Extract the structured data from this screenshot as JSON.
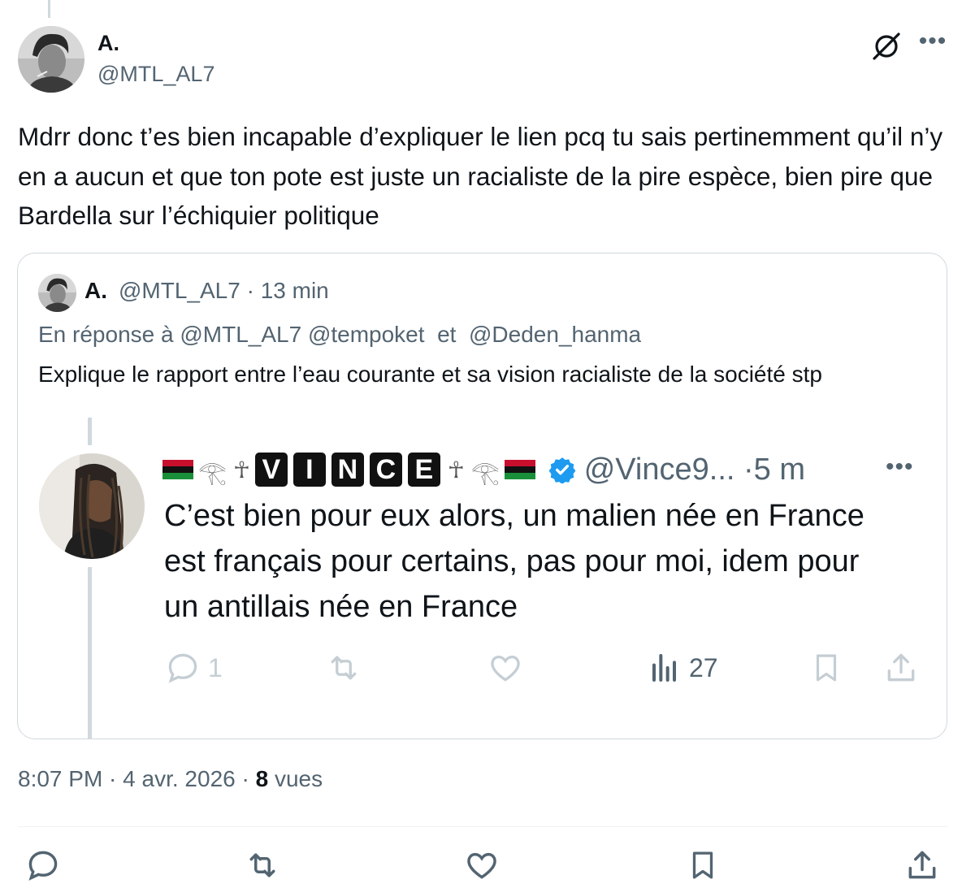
{
  "author": {
    "name": "A.",
    "handle": "@MTL_AL7",
    "avatar_icon": "portrait-avatar-icon"
  },
  "header_icons": [
    "grok-icon",
    "more-icon"
  ],
  "tweet": {
    "text": "Mdrr donc t’es bien incapable d’expliquer le lien pcq tu sais pertinemment qu’il n’y en a aucun et que ton pote est juste un racialiste de la pire espèce, bien pire que Bardella sur l’échiquier politique"
  },
  "quote": {
    "name": "A.",
    "handle_time": "@MTL_AL7 · 13 min",
    "reply_to": "En réponse à @MTL_AL7 @tempoket  et  @Deden_hanma",
    "text": "Explique le rapport entre l’eau courante et sa vision racialiste de la société stp",
    "inner": {
      "name_letters": [
        "V",
        "I",
        "N",
        "C",
        "E"
      ],
      "handle_time": "@Vince9... ·5 m",
      "text": "C’est bien pour eux alors, un malien née en France est français pour certains, pas pour moi,  idem pour un antillais née en France",
      "reply_count": "1",
      "views_count": "27"
    }
  },
  "meta": {
    "time": "8:07 PM · 4 avr. 2026 · ",
    "views": "8",
    "views_label": " vues"
  },
  "colors": {
    "text_primary": "#0f1419",
    "text_secondary": "#536471",
    "border": "#cfd9de",
    "verified_blue": "#1d9bf0"
  }
}
